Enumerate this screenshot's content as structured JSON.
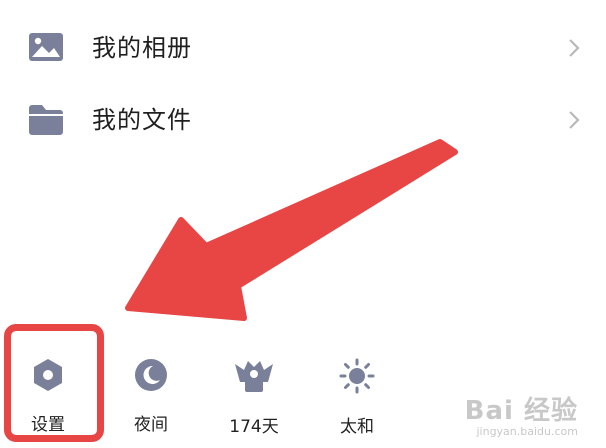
{
  "menu": {
    "items": [
      {
        "label": "我的相册",
        "icon": "photo-album-icon"
      },
      {
        "label": "我的文件",
        "icon": "folder-icon"
      }
    ]
  },
  "bottom_bar": {
    "items": [
      {
        "label": "设置",
        "icon": "gear-icon"
      },
      {
        "label": "夜间",
        "icon": "moon-icon"
      },
      {
        "label": "174天",
        "icon": "badge-icon"
      },
      {
        "label": "太和",
        "icon": "sun-icon"
      }
    ]
  },
  "annotation": {
    "color": "#e84545",
    "target": "settings"
  },
  "watermark": {
    "main": "Bai 经验",
    "sub": "jingyan.baidu.com"
  },
  "colors": {
    "icon": "#7a7f9a",
    "text": "#1f1f1f",
    "chevron": "#b9b9b9",
    "annotation": "#e84545"
  }
}
